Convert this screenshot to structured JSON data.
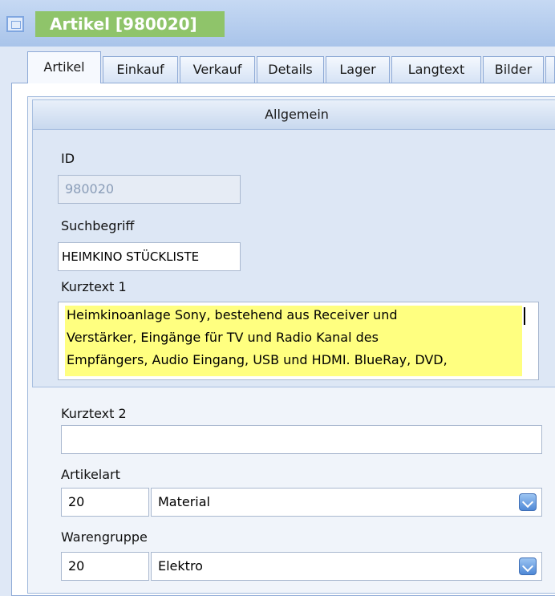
{
  "window": {
    "title": "Artikel [980020]"
  },
  "tabs": [
    {
      "label": "Artikel"
    },
    {
      "label": "Einkauf"
    },
    {
      "label": "Verkauf"
    },
    {
      "label": "Details"
    },
    {
      "label": "Lager"
    },
    {
      "label": "Langtext"
    },
    {
      "label": "Bilder"
    }
  ],
  "group": {
    "title": "Allgemein"
  },
  "form": {
    "id_label": "ID",
    "id_value": "980020",
    "suchbegriff_label": "Suchbegriff",
    "suchbegriff_value": "HEIMKINO STÜCKLISTE",
    "kurztext1_label": "Kurztext 1",
    "kurztext1_lines": [
      "Heimkinoanlage Sony, bestehend aus Receiver und",
      "Verstärker, Eingänge für TV und Radio Kanal des",
      "Empfängers, Audio Eingang, USB und HDMI. BlueRay, DVD,"
    ],
    "kurztext2_label": "Kurztext 2",
    "kurztext2_value": "",
    "artikelart_label": "Artikelart",
    "artikelart_code": "20",
    "artikelart_value": "Material",
    "warengruppe_label": "Warengruppe",
    "warengruppe_code": "20",
    "warengruppe_value": "Elektro"
  },
  "icons": {
    "window": "window-icon",
    "dropdown": "chevron-down-icon"
  },
  "colors": {
    "title_highlight": "#8fc46a",
    "text_highlight": "#ffff80",
    "accent": "#4f88d6"
  }
}
